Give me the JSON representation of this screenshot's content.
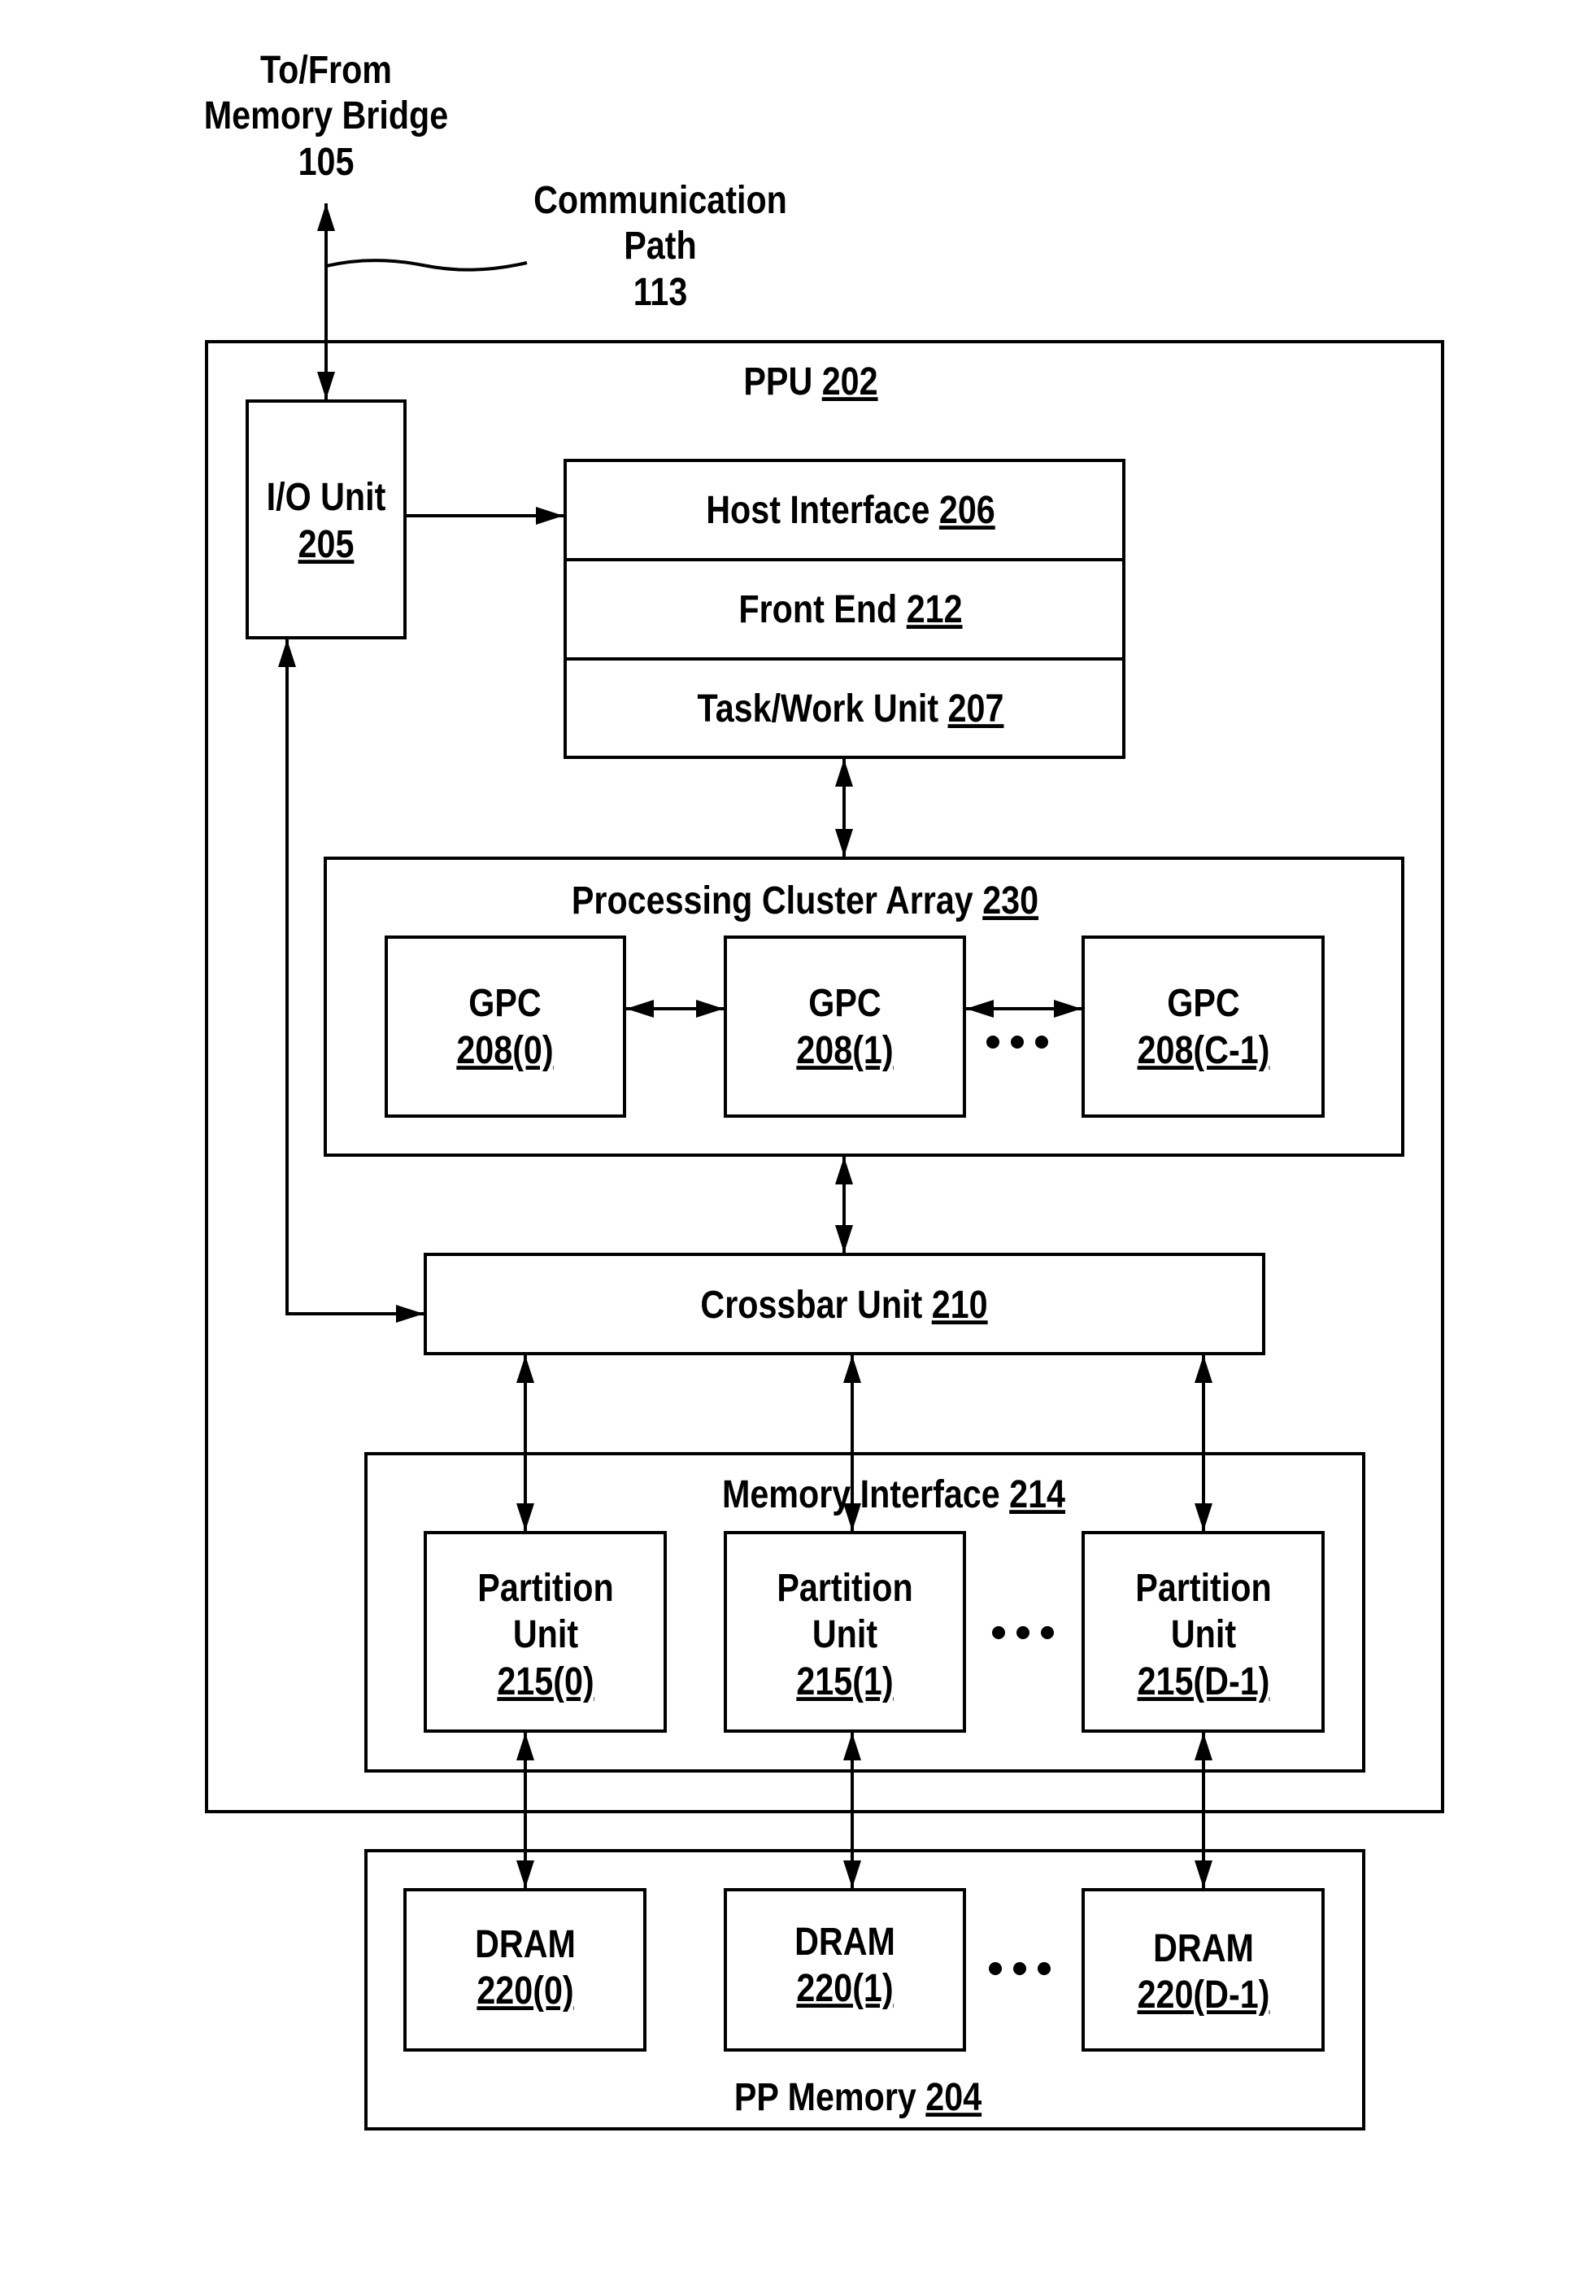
{
  "external": {
    "memory_bridge": {
      "lines": [
        "To/From",
        "Memory Bridge"
      ],
      "ref": "105"
    },
    "communication_path": {
      "lines": [
        "Communication",
        "Path"
      ],
      "ref": "113"
    }
  },
  "ppu": {
    "label": "PPU",
    "ref": "202"
  },
  "io_unit": {
    "label": "I/O Unit",
    "ref": "205"
  },
  "host_stack": [
    {
      "label": "Host Interface",
      "ref": "206"
    },
    {
      "label": "Front End",
      "ref": "212"
    },
    {
      "label": "Task/Work Unit",
      "ref": "207"
    }
  ],
  "processing_cluster_array": {
    "label": "Processing Cluster Array",
    "ref": "230",
    "gpcs": [
      {
        "label": "GPC",
        "ref": "208(0)"
      },
      {
        "label": "GPC",
        "ref": "208(1)"
      },
      {
        "label": "GPC",
        "ref": "208(C-1)"
      }
    ]
  },
  "crossbar": {
    "label": "Crossbar Unit",
    "ref": "210"
  },
  "memory_interface": {
    "label": "Memory Interface",
    "ref": "214",
    "partitions": [
      {
        "lines": [
          "Partition",
          "Unit"
        ],
        "ref": "215(0)"
      },
      {
        "lines": [
          "Partition",
          "Unit"
        ],
        "ref": "215(1)"
      },
      {
        "lines": [
          "Partition",
          "Unit"
        ],
        "ref": "215(D-1)"
      }
    ]
  },
  "pp_memory": {
    "label": "PP Memory",
    "ref": "204",
    "drams": [
      {
        "label": "DRAM",
        "ref": "220(0)"
      },
      {
        "label": "DRAM",
        "ref": "220(1)"
      },
      {
        "label": "DRAM",
        "ref": "220(D-1)"
      }
    ]
  }
}
